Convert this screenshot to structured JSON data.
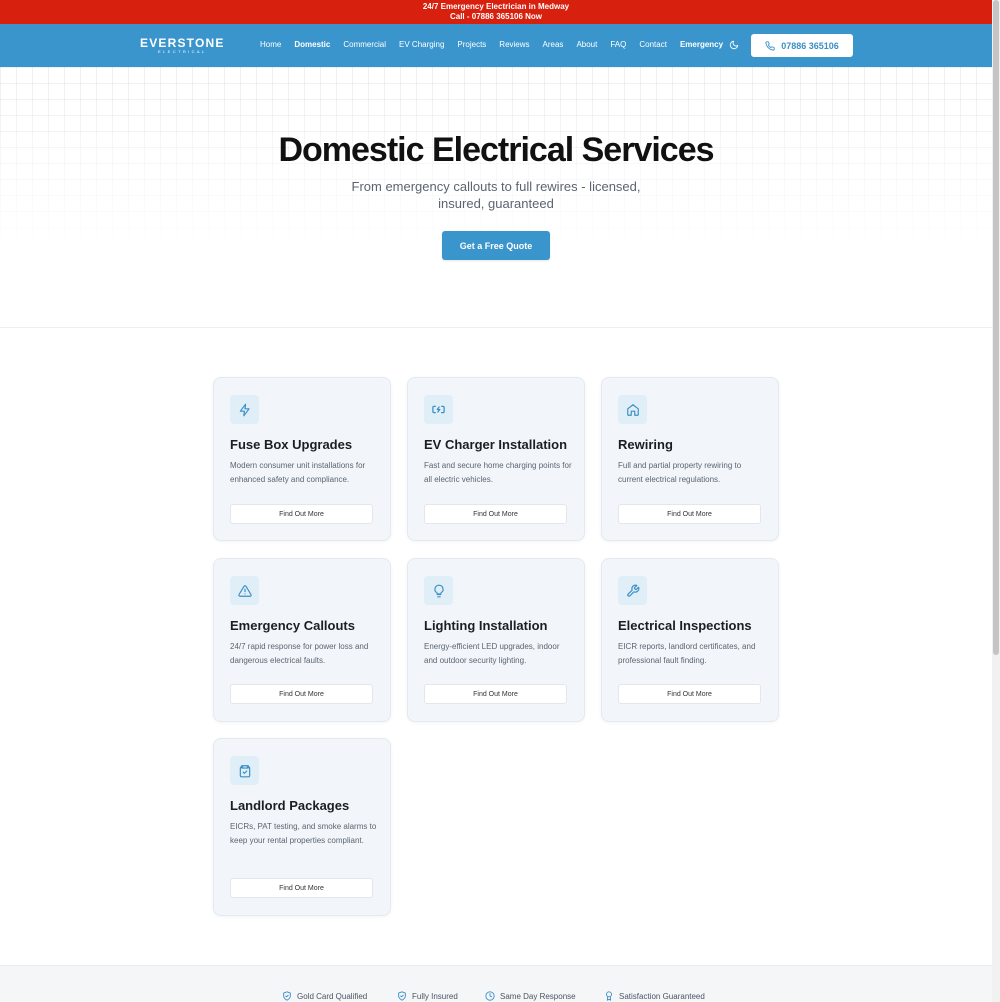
{
  "topbar": {
    "line1": "24/7 Emergency Electrician in Medway",
    "line2": "Call - 07886 365106 Now"
  },
  "nav": {
    "logo_main": "EVERSTONE",
    "logo_sub": "ELECTRICAL",
    "links": [
      "Home",
      "Domestic",
      "Commercial",
      "EV Charging",
      "Projects",
      "Reviews",
      "Areas",
      "About",
      "FAQ",
      "Contact",
      "Emergency"
    ],
    "active": "Domestic",
    "phone_label": "07886 365106",
    "theme_icon": "moon-icon"
  },
  "hero": {
    "title": "Domestic Electrical Services",
    "subtitle": "From emergency callouts to full rewires - licensed, insured, guaranteed",
    "cta_label": "Get a Free Quote"
  },
  "services": [
    {
      "title": "Fuse Box Upgrades",
      "desc": "Modern consumer unit installations for enhanced safety and compliance.",
      "button": "Find Out More",
      "icon": "lightning-icon"
    },
    {
      "title": "EV Charger Installation",
      "desc": "Fast and secure home charging points for all electric vehicles.",
      "button": "Find Out More",
      "icon": "ev-charger-icon"
    },
    {
      "title": "Rewiring",
      "desc": "Full and partial property rewiring to current electrical regulations.",
      "button": "Find Out More",
      "icon": "home-icon"
    },
    {
      "title": "Emergency Callouts",
      "desc": "24/7 rapid response for power loss and dangerous electrical faults.",
      "button": "Find Out More",
      "icon": "warning-icon"
    },
    {
      "title": "Lighting Installation",
      "desc": "Energy-efficient LED upgrades, indoor and outdoor security lighting.",
      "button": "Find Out More",
      "icon": "lightbulb-icon"
    },
    {
      "title": "Electrical Inspections",
      "desc": "EICR reports, landlord certificates, and professional fault finding.",
      "button": "Find Out More",
      "icon": "wrench-icon"
    },
    {
      "title": "Landlord Packages",
      "desc": "EICRs, PAT testing, and smoke alarms to keep your rental properties compliant.",
      "button": "Find Out More",
      "icon": "clipboard-check-icon"
    }
  ],
  "badges": [
    {
      "label": "Gold Card Qualified",
      "icon": "shield-check-icon"
    },
    {
      "label": "Fully Insured",
      "icon": "shield-check-icon"
    },
    {
      "label": "Same Day Response",
      "icon": "clock-icon"
    },
    {
      "label": "Satisfaction Guaranteed",
      "icon": "award-icon"
    }
  ],
  "colors": {
    "emergency_bar": "#d8200f",
    "brand_blue": "#3a95cc",
    "card_bg": "#f2f6fa"
  }
}
